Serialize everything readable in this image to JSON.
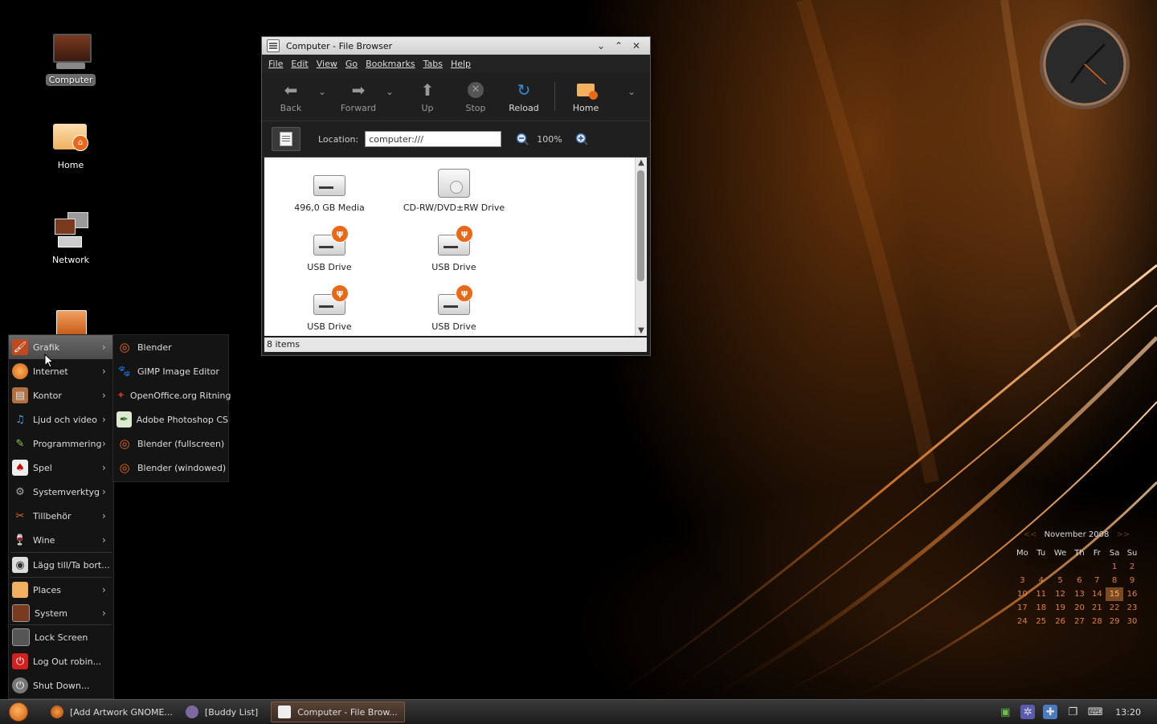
{
  "desktop": {
    "icons": [
      {
        "label": "Computer",
        "selected": true,
        "icon": "computer-icon"
      },
      {
        "label": "Home",
        "icon": "home-folder-icon"
      },
      {
        "label": "Network",
        "icon": "network-icon"
      },
      {
        "label": "",
        "icon": "trash-icon"
      }
    ]
  },
  "window": {
    "title": "Computer - File Browser",
    "menus": [
      "File",
      "Edit",
      "View",
      "Go",
      "Bookmarks",
      "Tabs",
      "Help"
    ],
    "toolbar": {
      "back": "Back",
      "forward": "Forward",
      "up": "Up",
      "stop": "Stop",
      "reload": "Reload",
      "home": "Home"
    },
    "location_label": "Location:",
    "location_value": "computer:///",
    "zoom": "100%",
    "items": [
      {
        "label": "496,0 GB Media",
        "type": "hdd"
      },
      {
        "label": "CD-RW/DVD±RW Drive",
        "type": "cd"
      },
      {
        "label": "USB Drive",
        "type": "usb"
      },
      {
        "label": "USB Drive",
        "type": "usb"
      },
      {
        "label": "USB Drive",
        "type": "usb"
      },
      {
        "label": "USB Drive",
        "type": "usb"
      }
    ],
    "status": "8 items"
  },
  "main_menu": {
    "items": [
      {
        "label": "Grafik",
        "submenu": true,
        "highlighted": true
      },
      {
        "label": "Internet",
        "submenu": true
      },
      {
        "label": "Kontor",
        "submenu": true
      },
      {
        "label": "Ljud och video",
        "submenu": true
      },
      {
        "label": "Programmering",
        "submenu": true
      },
      {
        "label": "Spel",
        "submenu": true
      },
      {
        "label": "Systemverktyg",
        "submenu": true
      },
      {
        "label": "Tillbehör",
        "submenu": true
      },
      {
        "label": "Wine",
        "submenu": true
      },
      {
        "label": "Lägg till/Ta bort...",
        "submenu": false
      },
      {
        "label": "Places",
        "submenu": true
      },
      {
        "label": "System",
        "submenu": true
      },
      {
        "label": "Lock Screen",
        "submenu": false
      },
      {
        "label": "Log Out robin...",
        "submenu": false
      },
      {
        "label": "Shut Down...",
        "submenu": false
      }
    ]
  },
  "sub_menu": {
    "items": [
      {
        "label": "Blender"
      },
      {
        "label": "GIMP Image Editor"
      },
      {
        "label": "OpenOffice.org Ritning"
      },
      {
        "label": "Adobe Photoshop CS"
      },
      {
        "label": "Blender (fullscreen)"
      },
      {
        "label": "Blender (windowed)"
      }
    ]
  },
  "taskbar": {
    "tasks": [
      {
        "label": "[Add Artwork GNOME..."
      },
      {
        "label": "[Buddy List]"
      },
      {
        "label": "Computer - File Brow...",
        "active": true
      }
    ],
    "time": "13:20"
  },
  "calendar": {
    "month": "November",
    "year": "2008",
    "prev": "<<",
    "next": ">>",
    "weekdays": [
      "Mo",
      "Tu",
      "We",
      "Th",
      "Fr",
      "Sa",
      "Su"
    ],
    "weeks": [
      [
        "",
        "",
        "",
        "",
        "",
        "1",
        "2"
      ],
      [
        "3",
        "4",
        "5",
        "6",
        "7",
        "8",
        "9"
      ],
      [
        "10",
        "11",
        "12",
        "13",
        "14",
        "15",
        "16"
      ],
      [
        "17",
        "18",
        "19",
        "20",
        "21",
        "22",
        "23"
      ],
      [
        "24",
        "25",
        "26",
        "27",
        "28",
        "29",
        "30"
      ]
    ],
    "today": "15"
  },
  "colors": {
    "accent": "#e8691a",
    "calendar_day": "#e0823c"
  }
}
